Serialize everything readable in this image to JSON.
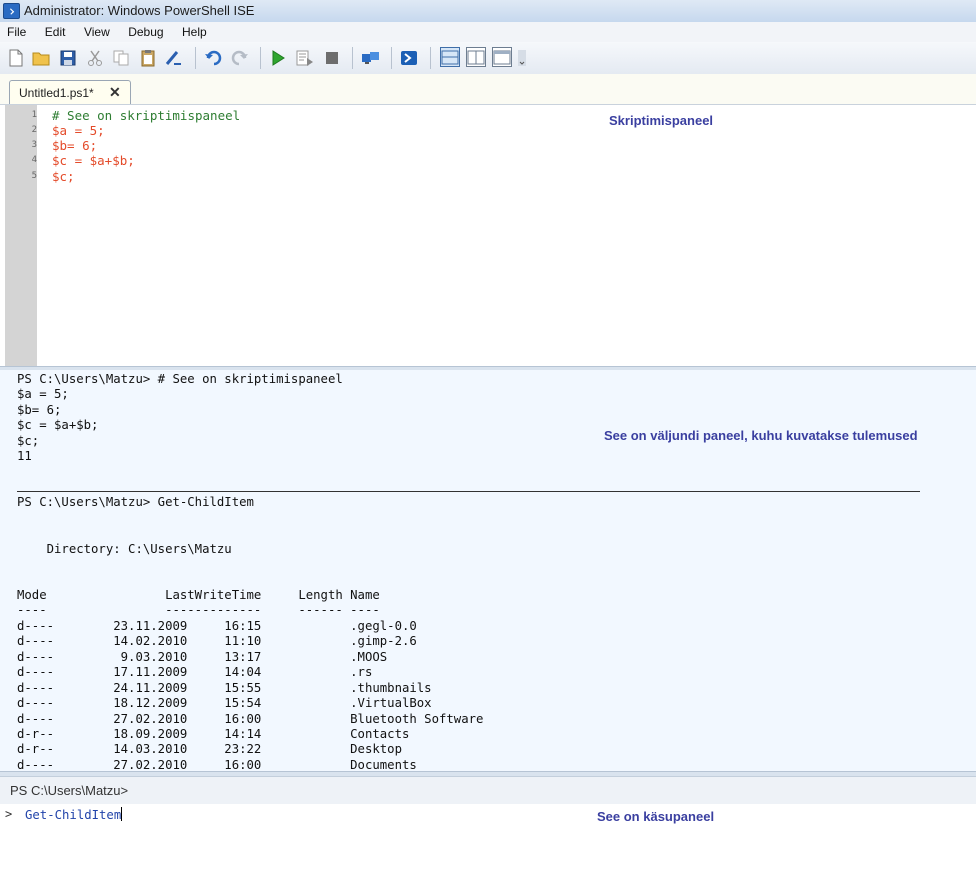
{
  "window": {
    "title": "Administrator: Windows PowerShell ISE"
  },
  "menu": [
    "File",
    "Edit",
    "View",
    "Debug",
    "Help"
  ],
  "toolbar": {
    "icons": [
      "new-file-icon",
      "open-folder-icon",
      "save-icon",
      "cut-icon",
      "copy-icon",
      "paste-icon",
      "clear-icon",
      "undo-icon",
      "redo-icon",
      "run-icon",
      "run-selection-icon",
      "stop-icon",
      "remote-tab-icon",
      "powershell-icon",
      "layout-top-icon",
      "layout-side-icon",
      "layout-maximize-icon"
    ]
  },
  "tab": {
    "label": "Untitled1.ps1*"
  },
  "script": {
    "line_numbers": [
      "1",
      "2",
      "3",
      "4",
      "5"
    ],
    "lines": [
      "# See on skriptimispaneel",
      "$a = 5;",
      "$b= 6;",
      "$c = $a+$b;",
      "$c;"
    ],
    "annotation": "Skriptimispaneel"
  },
  "output": {
    "lines": [
      "PS C:\\Users\\Matzu> # See on skriptimispaneel",
      "$a = 5;",
      "$b= 6;",
      "$c = $a+$b;",
      "$c;",
      "11",
      "PS C:\\Users\\Matzu> Get-ChildItem",
      "    Directory: C:\\Users\\Matzu",
      "Mode                LastWriteTime     Length Name",
      "----                -------------     ------ ----",
      "d----        23.11.2009     16:15            .gegl-0.0",
      "d----        14.02.2010     11:10            .gimp-2.6",
      "d----         9.03.2010     13:17            .MOOS",
      "d----        17.11.2009     14:04            .rs",
      "d----        24.11.2009     15:55            .thumbnails",
      "d----        18.12.2009     15:54            .VirtualBox",
      "d----        27.02.2010     16:00            Bluetooth Software",
      "d-r--        18.09.2009     14:14            Contacts",
      "d-r--        14.03.2010     23:22            Desktop",
      "d----        27.02.2010     16:00            Documents"
    ],
    "annotation": "See on väljundi paneel, kuhu kuvatakse tulemused"
  },
  "command": {
    "prompt": "PS C:\\Users\\Matzu>",
    "chevron": ">",
    "input": "Get-ChildItem",
    "annotation": "See on käsupaneel"
  }
}
